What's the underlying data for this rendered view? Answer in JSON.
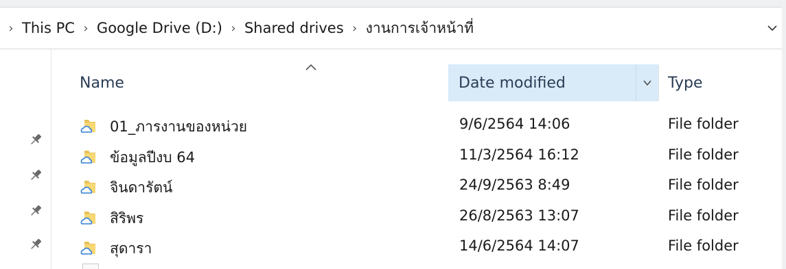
{
  "breadcrumb": {
    "items": [
      "This PC",
      "Google Drive (D:)",
      "Shared drives",
      "งานการเจ้าหน้าที่"
    ]
  },
  "columns": {
    "name": "Name",
    "date_modified": "Date modified",
    "type": "Type",
    "sorted_by": "Date modified"
  },
  "files": [
    {
      "name": "01_ภารงานของหน่วย",
      "date": "9/6/2564 14:06",
      "type": "File folder"
    },
    {
      "name": "ข้อมูลปีงบ 64",
      "date": "11/3/2564 16:12",
      "type": "File folder"
    },
    {
      "name": "จินดารัตน์",
      "date": "24/9/2563 8:49",
      "type": "File folder"
    },
    {
      "name": "สิริพร",
      "date": "26/8/2563 13:07",
      "type": "File folder"
    },
    {
      "name": "สุดารา",
      "date": "14/6/2564 14:07",
      "type": "File folder"
    }
  ],
  "icons": {
    "folder": "google-drive-folder-icon",
    "pin": "pin-icon",
    "separator": "chevron-right-icon"
  },
  "colors": {
    "header_highlight": "#d9ebf9",
    "folder_yellow": "#f8d775",
    "cloud_blue": "#2f7fd6"
  }
}
